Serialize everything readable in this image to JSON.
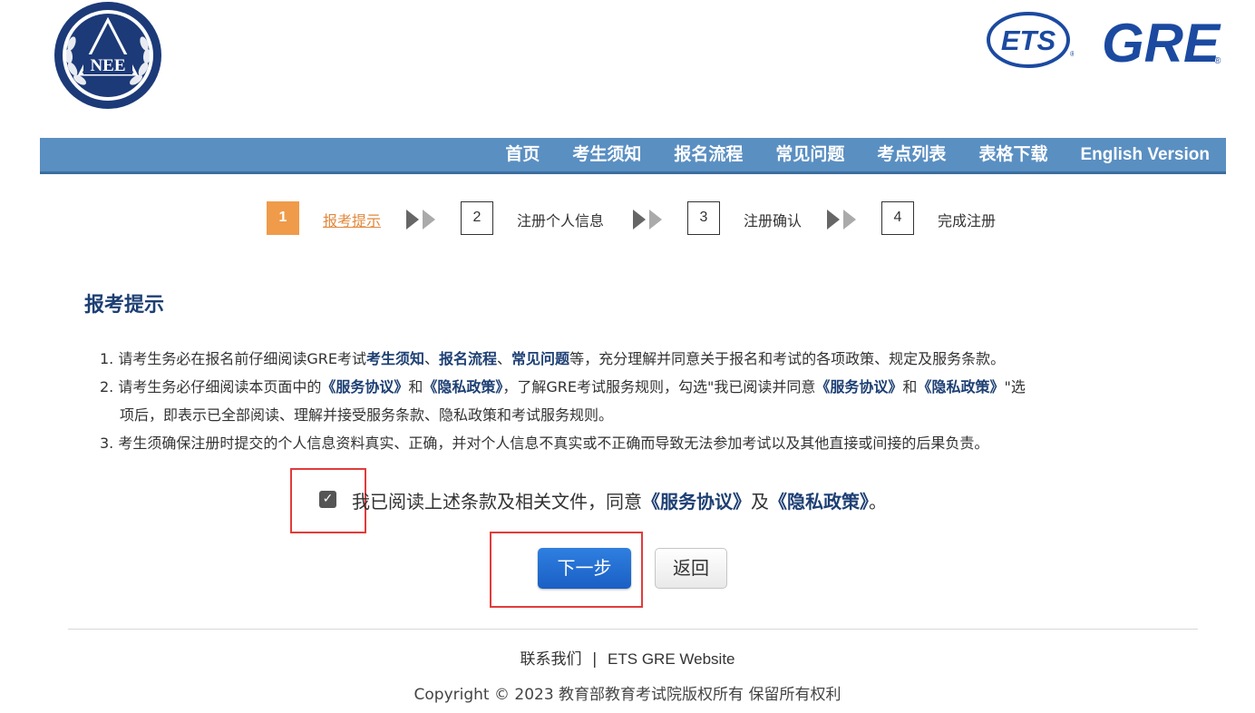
{
  "header": {
    "left_logo_text": "NEE",
    "ets_logo_text": "ETS",
    "gre_logo_text": "GRE"
  },
  "nav": {
    "items": [
      {
        "label": "首页"
      },
      {
        "label": "考生须知"
      },
      {
        "label": "报名流程"
      },
      {
        "label": "常见问题"
      },
      {
        "label": "考点列表"
      },
      {
        "label": "表格下载"
      },
      {
        "label": "English Version"
      }
    ]
  },
  "steps": [
    {
      "number": "1",
      "label": "报考提示",
      "active": true
    },
    {
      "number": "2",
      "label": "注册个人信息",
      "active": false
    },
    {
      "number": "3",
      "label": "注册确认",
      "active": false
    },
    {
      "number": "4",
      "label": "完成注册",
      "active": false
    }
  ],
  "section_title": "报考提示",
  "instructions": {
    "line1": {
      "prefix": "1. 请考生务必在报名前仔细阅读GRE考试",
      "link1": "考生须知",
      "sep1": "、",
      "link2": "报名流程",
      "sep2": "、",
      "link3": "常见问题",
      "suffix": "等，充分理解并同意关于报名和考试的各项政策、规定及服务条款。"
    },
    "line2": {
      "prefix": "2. 请考生务必仔细阅读本页面中的",
      "link1": "《服务协议》",
      "mid1": "和",
      "link2": "《隐私政策》",
      "mid2": "，了解GRE考试服务规则，勾选\"我已阅读并同意",
      "link3": "《服务协议》",
      "mid3": "和",
      "link4": "《隐私政策》",
      "suffix": "\"选"
    },
    "line2b": "项后，即表示已全部阅读、理解并接受服务条款、隐私政策和考试服务规则。",
    "line3": "3. 考生须确保注册时提交的个人信息资料真实、正确，并对个人信息不真实或不正确而导致无法参加考试以及其他直接或间接的后果负责。"
  },
  "agreement": {
    "checked": true,
    "text_prefix": "我已阅读上述条款及相关文件，同意",
    "link1": "《服务协议》",
    "middle": "及",
    "link2": "《隐私政策》",
    "suffix": "。"
  },
  "buttons": {
    "next": "下一步",
    "back": "返回"
  },
  "footer": {
    "contact": "联系我们",
    "separator": "|",
    "ets_link": "ETS GRE Website",
    "copyright": "Copyright © 2023 教育部教育考试院版权所有  保留所有权利"
  },
  "colors": {
    "nav_bg": "#5a8fc2",
    "brand_blue": "#1d3f73",
    "active_step": "#ef9b4a",
    "next_button": "#1a5fc4",
    "highlight_border": "#e23b3b"
  }
}
